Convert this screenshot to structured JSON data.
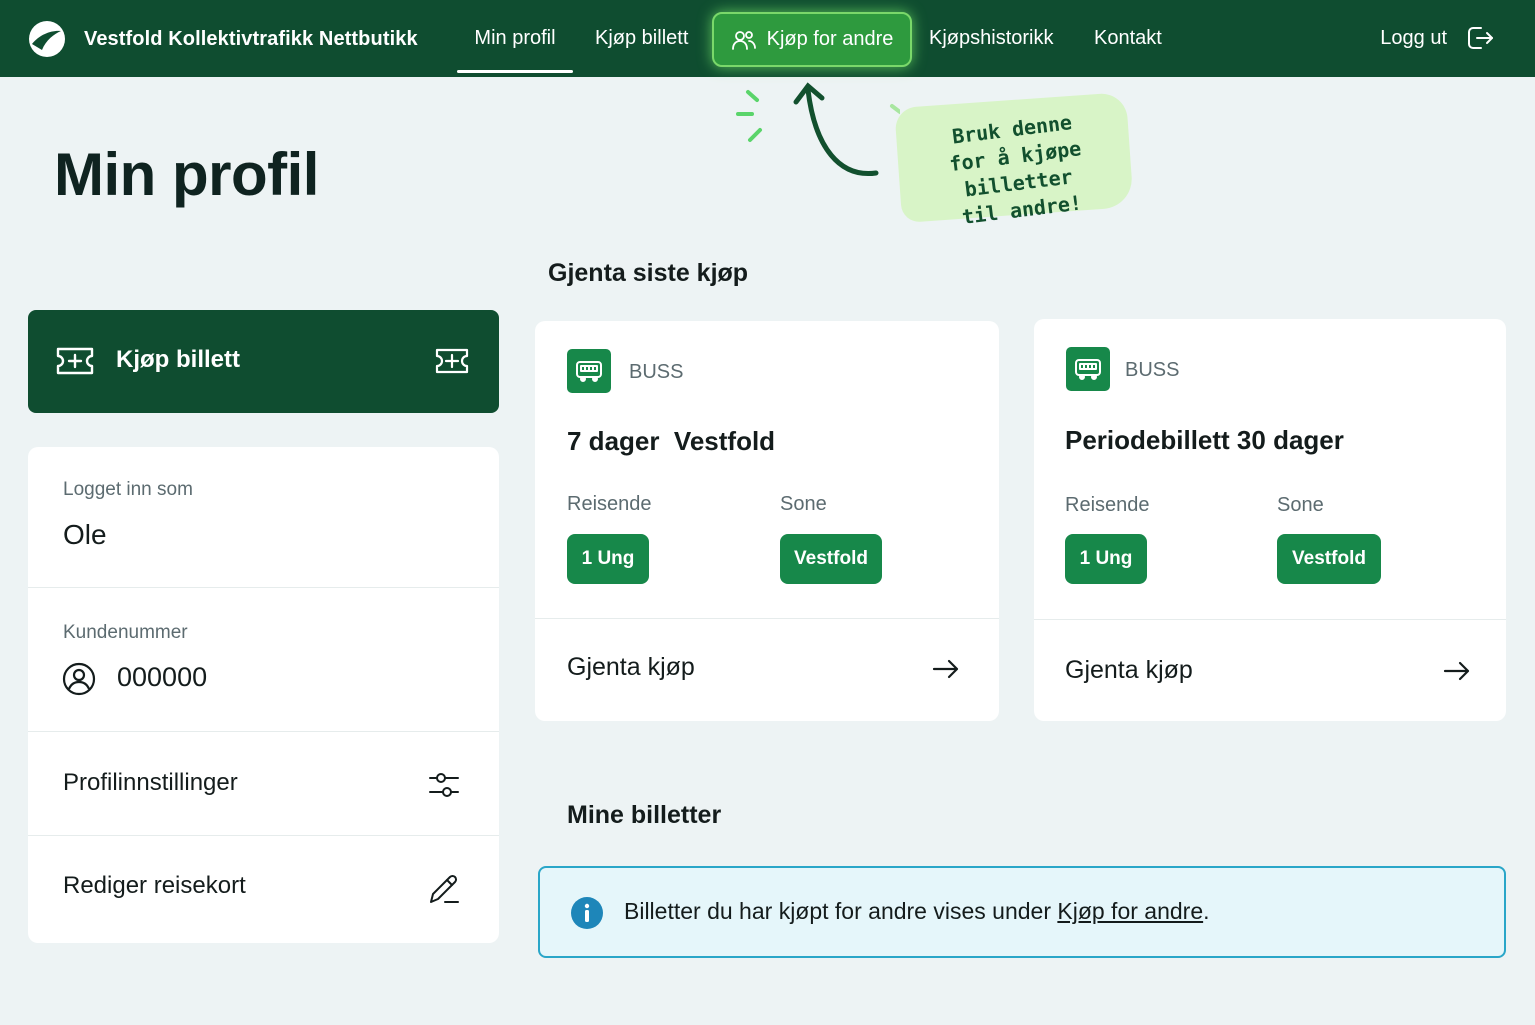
{
  "nav": {
    "brand": "Vestfold Kollektivtrafikk Nettbutikk",
    "items": [
      {
        "label": "Min profil",
        "active": true
      },
      {
        "label": "Kjøp billett"
      },
      {
        "label": "Kjøp for andre",
        "highlighted": true
      },
      {
        "label": "Kjøpshistorikk"
      },
      {
        "label": "Kontakt"
      }
    ],
    "logout": "Logg ut"
  },
  "callout": {
    "line1": "Bruk denne",
    "line2": "for å kjøpe billetter",
    "line3": "til andre!"
  },
  "page": {
    "title": "Min profil"
  },
  "left": {
    "buy_button": "Kjøp billett",
    "logged_in_label": "Logget inn som",
    "logged_in_value": "Ole",
    "customer_label": "Kundenummer",
    "customer_value": "000000",
    "profile_settings": "Profilinnstillinger",
    "edit_travel_card": "Rediger reisekort"
  },
  "repeat_section": {
    "heading": "Gjenta siste kjøp",
    "cards": [
      {
        "mode": "BUSS",
        "title": "7 dager  Vestfold",
        "travellers_label": "Reisende",
        "travellers": "1 Ung",
        "zone_label": "Sone",
        "zone": "Vestfold",
        "action": "Gjenta kjøp"
      },
      {
        "mode": "BUSS",
        "title": "Periodebillett 30 dager",
        "travellers_label": "Reisende",
        "travellers": "1 Ung",
        "zone_label": "Sone",
        "zone": "Vestfold",
        "action": "Gjenta kjøp"
      }
    ]
  },
  "tickets_section": {
    "heading": "Mine billetter",
    "info_prefix": "Billetter du har kjøpt for andre vises under ",
    "info_link": "Kjøp for andre",
    "info_suffix": "."
  },
  "colors": {
    "nav_bg": "#0f4d30",
    "accent_green": "#17884a",
    "highlight_green": "#2e9a3e",
    "callout_bg": "#d8f4c7",
    "info_border": "#2aa6c8",
    "info_bg": "#e5f6fa",
    "page_bg": "#edf3f4"
  },
  "icons": [
    "brand-logo-icon",
    "users-icon",
    "logout-icon",
    "ticket-plus-icon",
    "user-circle-icon",
    "sliders-icon",
    "pencil-icon",
    "bus-icon",
    "arrow-right-icon",
    "info-icon",
    "curved-arrow-icon"
  ]
}
